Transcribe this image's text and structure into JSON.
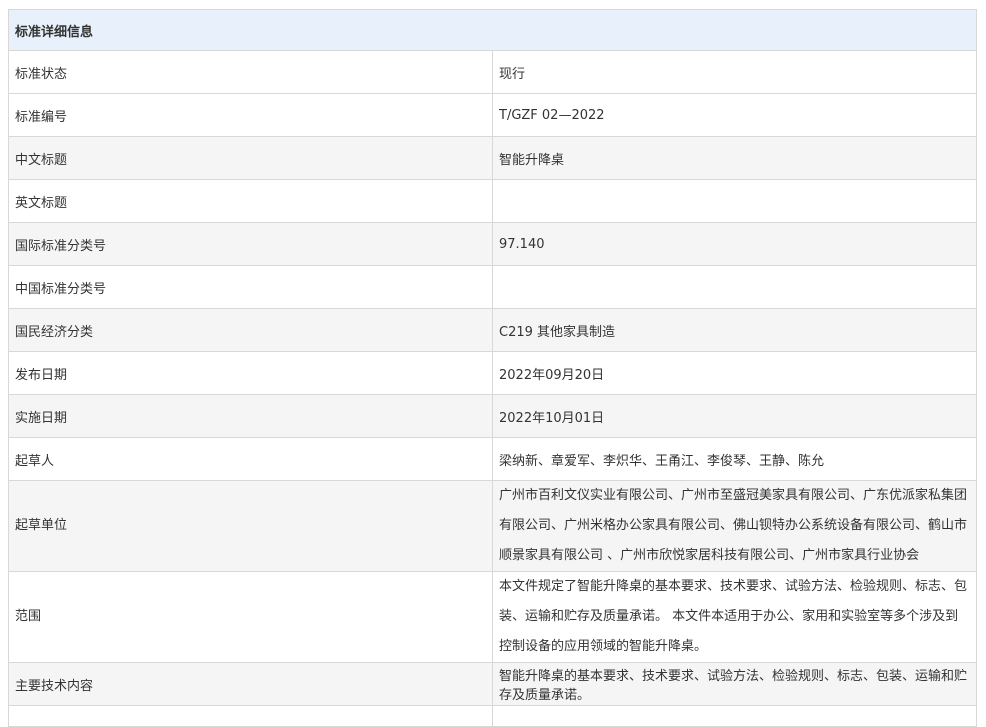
{
  "header": "标准详细信息",
  "rows": [
    {
      "label": "标准状态",
      "value": "现行"
    },
    {
      "label": "标准编号",
      "value": "T/GZF 02—2022"
    },
    {
      "label": "中文标题",
      "value": "智能升降桌"
    },
    {
      "label": "英文标题",
      "value": ""
    },
    {
      "label": "国际标准分类号",
      "value": "97.140"
    },
    {
      "label": "中国标准分类号",
      "value": ""
    },
    {
      "label": "国民经济分类",
      "value": "C219 其他家具制造"
    },
    {
      "label": "发布日期",
      "value": "2022年09月20日"
    },
    {
      "label": "实施日期",
      "value": "2022年10月01日"
    },
    {
      "label": "起草人",
      "value": "梁纳新、章爱军、李炽华、王甬江、李俊琴、王静、陈允"
    },
    {
      "label": "起草单位",
      "value": "广州市百利文仪实业有限公司、广州市至盛冠美家具有限公司、广东优派家私集团有限公司、广州米格办公家具有限公司、佛山钡特办公系统设备有限公司、鹤山市顺景家具有限公司 、广州市欣悦家居科技有限公司、广州市家具行业协会"
    },
    {
      "label": "范围",
      "value": "本文件规定了智能升降桌的基本要求、技术要求、试验方法、检验规则、标志、包装、运输和贮存及质量承诺。 本文件本适用于办公、家用和实验室等多个涉及到控制设备的应用领域的智能升降桌。"
    },
    {
      "label": "主要技术内容",
      "value": "智能升降桌的基本要求、技术要求、试验方法、检验规则、标志、包装、运输和贮存及质量承诺。"
    }
  ]
}
